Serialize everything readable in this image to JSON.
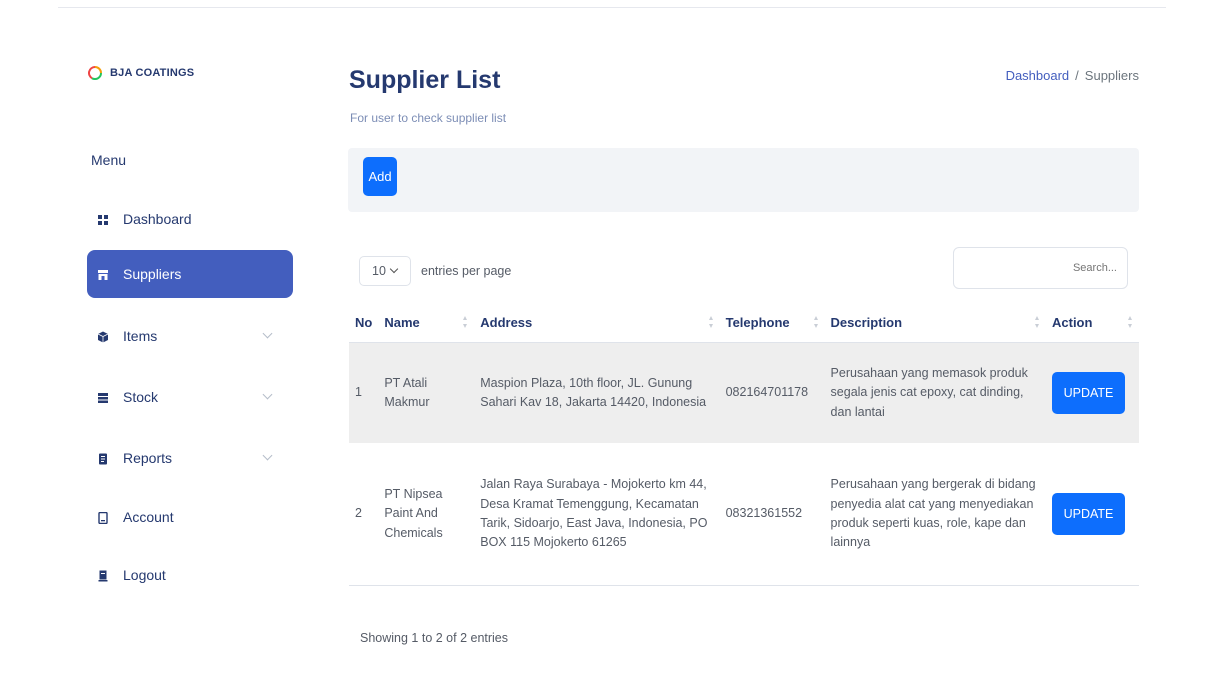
{
  "brand": {
    "name": "BJA COATINGS"
  },
  "sidebar": {
    "menu_title": "Menu",
    "items": [
      {
        "label": "Dashboard",
        "icon": "grid-icon",
        "active": false,
        "has_submenu": false
      },
      {
        "label": "Suppliers",
        "icon": "shop-icon",
        "active": true,
        "has_submenu": false
      },
      {
        "label": "Items",
        "icon": "box-icon",
        "active": false,
        "has_submenu": true
      },
      {
        "label": "Stock",
        "icon": "stack-icon",
        "active": false,
        "has_submenu": true
      },
      {
        "label": "Reports",
        "icon": "report-icon",
        "active": false,
        "has_submenu": true
      },
      {
        "label": "Account",
        "icon": "account-icon",
        "active": false,
        "has_submenu": false
      },
      {
        "label": "Logout",
        "icon": "logout-icon",
        "active": false,
        "has_submenu": false
      }
    ]
  },
  "header": {
    "title": "Supplier List",
    "subtitle": "For user to check supplier list",
    "breadcrumb": {
      "home": "Dashboard",
      "separator": "/",
      "current": "Suppliers"
    }
  },
  "toolbar": {
    "add_label": "Add"
  },
  "table_controls": {
    "entries_value": "10",
    "entries_label": "entries per page",
    "search_placeholder": "Search..."
  },
  "table": {
    "columns": [
      "No",
      "Name",
      "Address",
      "Telephone",
      "Description",
      "Action"
    ],
    "rows": [
      {
        "no": "1",
        "name": "PT Atali Makmur",
        "address": "Maspion Plaza, 10th floor, JL. Gunung Sahari Kav 18, Jakarta 14420, Indonesia",
        "telephone": "082164701178",
        "description": "Perusahaan yang memasok produk segala jenis cat epoxy, cat dinding, dan lantai",
        "action": "UPDATE"
      },
      {
        "no": "2",
        "name": "PT Nipsea Paint And Chemicals",
        "address": "Jalan Raya Surabaya - Mojokerto km 44, Desa Kramat Temenggung, Kecamatan Tarik, Sidoarjo, East Java, Indonesia, PO BOX 115 Mojokerto 61265",
        "telephone": "08321361552",
        "description": "Perusahaan yang bergerak di bidang penyedia alat cat yang menyediakan produk seperti kuas, role, kape dan lainnya",
        "action": "UPDATE"
      }
    ]
  },
  "footer": {
    "showing": "Showing 1 to 2 of 2 entries"
  },
  "colors": {
    "primary": "#435ebe",
    "button": "#0d6efd",
    "text": "#25396f"
  }
}
